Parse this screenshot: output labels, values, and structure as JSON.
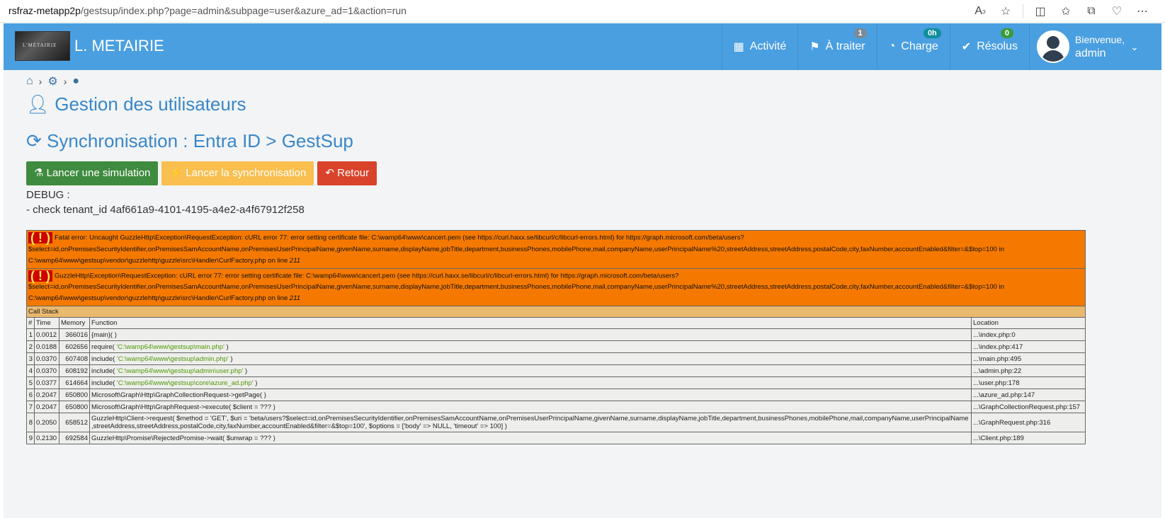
{
  "browser": {
    "host": "rsfraz-metapp2p",
    "path": "/gestsup/index.php?page=admin&subpage=user&azure_ad=1&action=run"
  },
  "app": {
    "logo_text": "L'MÉTAIRIE",
    "title": "L. METAIRIE"
  },
  "nav": {
    "activity": "Activité",
    "todo": "À traiter",
    "todo_badge": "1",
    "charge": "Charge",
    "charge_badge": "0h",
    "resolved": "Résolus",
    "resolved_badge": "0",
    "welcome": "Bienvenue,",
    "username": "admin"
  },
  "page": {
    "title": "Gestion des utilisateurs",
    "subtitle": "Synchronisation : Entra ID > GestSup",
    "btn_simulation": "Lancer une simulation",
    "btn_sync": "Lancer la synchronisation",
    "btn_back": "Retour",
    "debug_label": "DEBUG :",
    "debug_line": "- check tenant_id 4af661a9-4101-4195-a4e2-a4f67912f258"
  },
  "errors": {
    "fatal": "Fatal error: Uncaught GuzzleHttp\\Exception\\RequestException: cURL error 77: error setting certificate file: C:\\wamp64\\www\\cancert.pem (see https://curl.haxx.se/libcurl/c/libcurl-errors.html) for https://graph.microsoft.com/beta/users?$select=id,onPremisesSecurityIdentifier,onPremisesSamAccountName,onPremisesUserPrincipalName,givenName,surname,displayName,jobTitle,department,businessPhones,mobilePhone,mail,companyName,userPrincipalName%20,streetAddress,streetAddress,postalCode,city,faxNumber,accountEnabled&filter=&$top=100 in C:\\wamp64\\www\\gestsup\\vendor\\guzzlehttp\\guzzle\\src\\Handler\\CurlFactory.php on line",
    "fatal_line": "211",
    "exception": "GuzzleHttp\\Exception\\RequestException: cURL error 77: error setting certificate file: C:\\wamp64\\www\\cancert.pem (see https://curl.haxx.se/libcurl/c/libcurl-errors.html) for https://graph.microsoft.com/beta/users?$select=id,onPremisesSecurityIdentifier,onPremisesSamAccountName,onPremisesUserPrincipalName,givenName,surname,displayName,jobTitle,department,businessPhones,mobilePhone,mail,companyName,userPrincipalName%20,streetAddress,streetAddress,postalCode,city,faxNumber,accountEnabled&filter=&$top=100 in C:\\wamp64\\www\\gestsup\\vendor\\guzzlehttp\\guzzle\\src\\Handler\\CurlFactory.php on line",
    "exception_line": "211",
    "bang": "( ! )"
  },
  "callstack": {
    "title": "Call Stack",
    "headers": [
      "#",
      "Time",
      "Memory",
      "Function",
      "Location"
    ],
    "rows": [
      {
        "n": "1",
        "time": "0.0012",
        "mem": "366016",
        "fn": "{main}( )",
        "arg": "",
        "fn2": "",
        "loc": "...\\index.php:0"
      },
      {
        "n": "2",
        "time": "0.0188",
        "mem": "602656",
        "fn": "require( ",
        "arg": "'C:\\wamp64\\www\\gestsup\\main.php'",
        "fn2": " )",
        "loc": "...\\index.php:417"
      },
      {
        "n": "3",
        "time": "0.0370",
        "mem": "607408",
        "fn": "include( ",
        "arg": "'C:\\wamp64\\www\\gestsup\\admin.php'",
        "fn2": " )",
        "loc": "...\\main.php:495"
      },
      {
        "n": "4",
        "time": "0.0370",
        "mem": "608192",
        "fn": "include( ",
        "arg": "'C:\\wamp64\\www\\gestsup\\admin\\user.php'",
        "fn2": " )",
        "loc": "...\\admin.php:22"
      },
      {
        "n": "5",
        "time": "0.0377",
        "mem": "614664",
        "fn": "include( ",
        "arg": "'C:\\wamp64\\www\\gestsup\\core\\azure_ad.php'",
        "fn2": " )",
        "loc": "...\\user.php:178"
      },
      {
        "n": "6",
        "time": "0.2047",
        "mem": "650800",
        "fn": "Microsoft\\Graph\\Http\\GraphCollectionRequest->getPage( )",
        "arg": "",
        "fn2": "",
        "loc": "...\\azure_ad.php:147"
      },
      {
        "n": "7",
        "time": "0.2047",
        "mem": "650800",
        "fn": "Microsoft\\Graph\\Http\\GraphRequest->execute( $client = ??? )",
        "arg": "",
        "fn2": "",
        "loc": "...\\GraphCollectionRequest.php:157"
      },
      {
        "n": "8",
        "time": "0.2050",
        "mem": "658512",
        "fn": "GuzzleHttp\\Client->request( $method = 'GET', $uri = 'beta/users?$select=id,onPremisesSecurityIdentifier,onPremisesSamAccountName,onPremisesUserPrincipalName,givenName,surname,displayName,jobTitle,department,businessPhones,mobilePhone,mail,companyName,userPrincipalName ,streetAddress,streetAddress,postalCode,city,faxNumber,accountEnabled&filter=&$top=100', $options = ['body' => NULL, 'timeout' => 100] )",
        "arg": "",
        "fn2": "",
        "loc": "...\\GraphRequest.php:316"
      },
      {
        "n": "9",
        "time": "0.2130",
        "mem": "692584",
        "fn": "GuzzleHttp\\Promise\\RejectedPromise->wait( $unwrap = ??? )",
        "arg": "",
        "fn2": "",
        "loc": "...\\Client.php:189"
      }
    ]
  }
}
